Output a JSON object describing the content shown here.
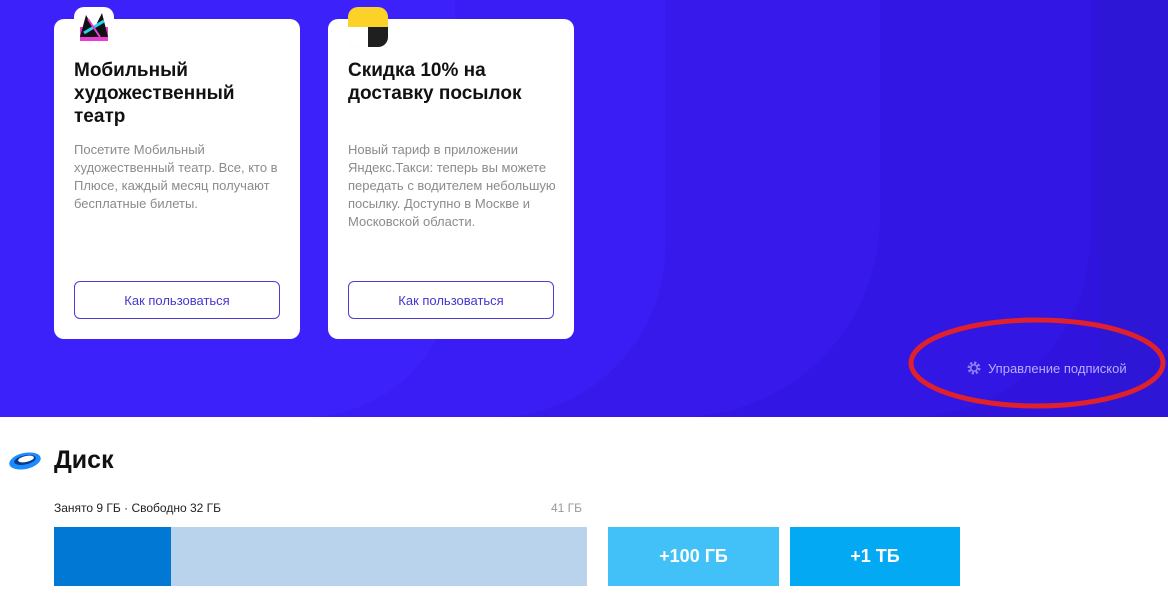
{
  "plus": {
    "cards": [
      {
        "title": "Мобильный художественный театр",
        "description": "Посетите Мобильный художественный театр. Все, кто в Плюсе, каждый месяц получают бесплатные билеты.",
        "button_label": "Как пользоваться",
        "icon": "mxat-logo-icon"
      },
      {
        "title": "Скидка 10% на доставку посылок",
        "description": "Новый тариф в приложении Яндекс.Такси: теперь вы можете передать с водителем небольшую посылку. Доступно в Москве и Московской области.",
        "button_label": "Как пользоваться",
        "icon": "yandex-taxi-icon"
      }
    ],
    "manage_label": "Управление подпиской",
    "colors": {
      "hero_bg": "#3a1df5",
      "button_accent": "#4636cf",
      "highlight_ring": "#e0202a"
    }
  },
  "disk": {
    "title": "Диск",
    "icon": "yandex-disk-icon",
    "usage_label": "Занято 9 ГБ · Свободно 32 ГБ",
    "total_label": "41 ГБ",
    "used_fraction": 0.2195,
    "buy_options": [
      "+100 ГБ",
      "+1 ТБ"
    ],
    "colors": {
      "used": "#0078d4",
      "free": "#b9d3ed",
      "buy_100gb": "#41c1f8",
      "buy_1tb": "#04a9f4"
    }
  }
}
